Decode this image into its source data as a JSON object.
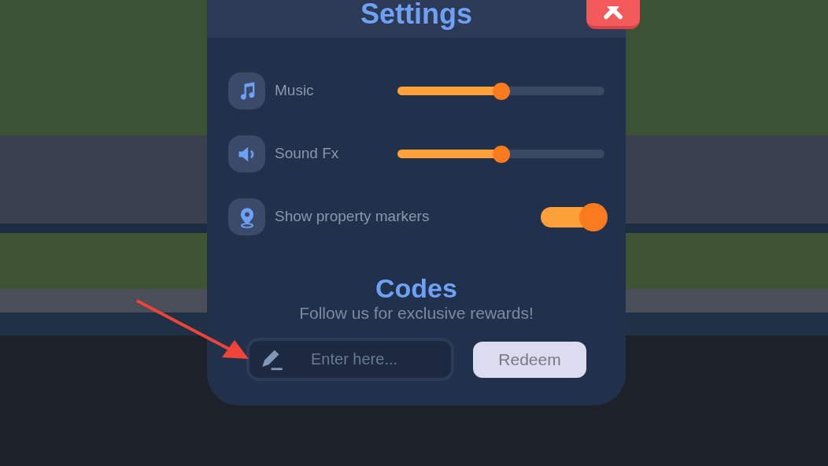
{
  "settings": {
    "title": "Settings",
    "rows": [
      {
        "kind": "slider",
        "label": "Music",
        "level": 0.5
      },
      {
        "kind": "slider",
        "label": "Sound Fx",
        "level": 0.5
      },
      {
        "kind": "toggle",
        "label": "Show property markers",
        "on": true
      }
    ]
  },
  "codes": {
    "title": "Codes",
    "subtitle": "Follow us for exclusive rewards!",
    "input": {
      "placeholder": "Enter here..."
    },
    "button": "Redeem"
  }
}
